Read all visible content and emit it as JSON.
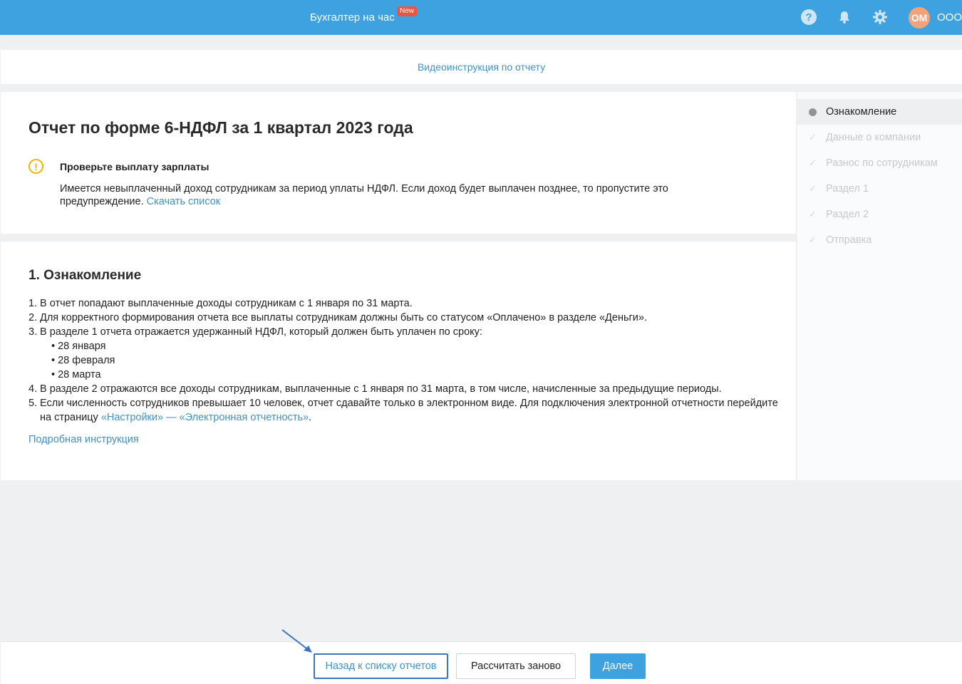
{
  "topbar": {
    "title": "Бухгалтер на час",
    "new_badge": "New",
    "help_glyph": "?",
    "avatar_initials": "ОМ",
    "org_name": "ООО"
  },
  "video_link": "Видеоинструкция по отчету",
  "report": {
    "title": "Отчет по форме 6-НДФЛ за 1 квартал 2023 года",
    "warning": {
      "icon": "!",
      "title": "Проверьте выплату зарплаты",
      "text": "Имеется невыплаченный доход сотрудникам за период уплаты НДФЛ. Если доход будет выплачен позднее, то пропустите это предупреждение.",
      "link": "Скачать список"
    }
  },
  "intro": {
    "title": "1. Ознакомление",
    "items": [
      {
        "num": "1.",
        "text": "В отчет попадают выплаченные доходы сотрудникам с 1 января по 31 марта."
      },
      {
        "num": "2.",
        "text": "Для корректного формирования отчета все выплаты сотрудникам должны быть со статусом «Оплачено» в разделе «Деньги»."
      },
      {
        "num": "3.",
        "text": "В разделе 1 отчета отражается удержанный НДФЛ, который должен быть уплачен по сроку:"
      },
      {
        "num": "4.",
        "text": "В разделе 2 отражаются все доходы сотрудникам, выплаченные с 1 января по 31 марта, в том числе, начисленные за предыдущие периоды."
      },
      {
        "num": "5.",
        "text": "Если численность сотрудников превышает 10 человек, отчет сдавайте только в электронном виде. Для подключения электронной отчетности перейдите на страницу",
        "link": "«Настройки» — «Электронная отчетность»",
        "tail": "."
      }
    ],
    "deadlines": [
      "• 28 января",
      "• 28 февраля",
      "• 28 марта"
    ],
    "detail_link": "Подробная инструкция"
  },
  "steps": [
    {
      "label": "Ознакомление",
      "state": "active"
    },
    {
      "label": "Данные о компании",
      "state": "pending"
    },
    {
      "label": "Разнос по сотрудникам",
      "state": "pending"
    },
    {
      "label": "Раздел 1",
      "state": "pending"
    },
    {
      "label": "Раздел 2",
      "state": "pending"
    },
    {
      "label": "Отправка",
      "state": "pending"
    }
  ],
  "footer": {
    "back_label": "Назад к списку отчетов",
    "recalc_label": "Рассчитать заново",
    "next_label": "Далее"
  },
  "colors": {
    "brand": "#3fa2e0",
    "link": "#3b93cf",
    "warning": "#f0b400",
    "badge": "#f0533d",
    "highlight": "#3a77c2"
  }
}
